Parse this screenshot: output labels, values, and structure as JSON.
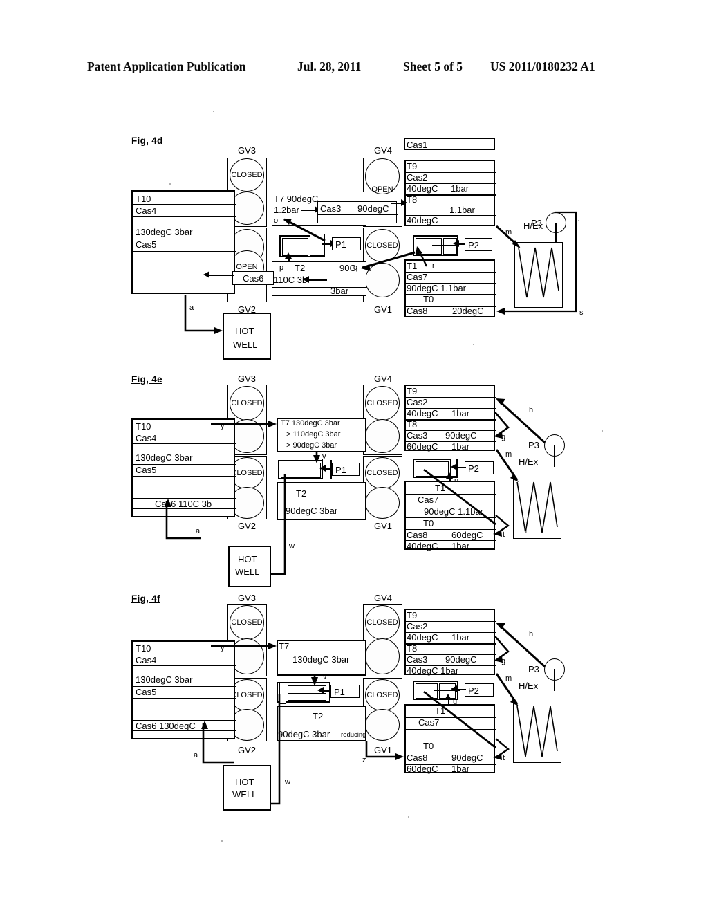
{
  "header": {
    "publication": "Patent Application Publication",
    "date": "Jul. 28, 2011",
    "sheet": "Sheet 5 of 5",
    "number": "US 2011/0180232 A1"
  },
  "figures": [
    {
      "id": "fig4d",
      "label": "Fig, 4d",
      "valve_stacks": [
        {
          "name": "GV3",
          "position": "top-left",
          "cells": [
            "CLOSED",
            ""
          ]
        },
        {
          "name": "GV2",
          "position": "bottom-left",
          "cells": [
            "",
            "OPEN"
          ]
        },
        {
          "name": "GV4",
          "position": "top-right",
          "cells": [
            "",
            "OPEN"
          ]
        },
        {
          "name": "GV1",
          "position": "bottom-right",
          "cells": [
            "CLOSED",
            ""
          ]
        }
      ],
      "left_vessel": {
        "rows": [
          "T10",
          "Cas4",
          "",
          "130degC 3bar",
          "Cas5",
          "",
          ""
        ]
      },
      "center": {
        "t7_label": "T7 90degC",
        "t7_pressure": "1.2bar",
        "t7_tap": "o",
        "cas3_label": "Cas3",
        "cas3_value": "90degC",
        "pump": "P1",
        "t2_tap": "p",
        "t2_label": "T2",
        "t2_temp": "90C",
        "t2_tap_right": "q",
        "cas6_label": "Cas6",
        "cas6_value": "110C 3b",
        "t2_pressure": "3bar"
      },
      "right_vessel": {
        "cas1": "Cas1",
        "rows": [
          {
            "t": "T9"
          },
          {
            "t": "Cas2"
          },
          {
            "t": "40degC",
            "v": "1bar"
          },
          {
            "t": "T8"
          },
          {
            "t": "",
            "v": "1.1bar"
          },
          {
            "t": "40degC"
          }
        ],
        "pump": "P2",
        "lower_rows": [
          {
            "t": "T1",
            "v": "r"
          },
          {
            "t": "Cas7"
          },
          {
            "t": "90degC 1.1bar"
          },
          {
            "t": "T0"
          },
          {
            "t": "Cas8",
            "v": "20degC"
          },
          {
            "t": ""
          }
        ]
      },
      "hx": {
        "pump": "P3",
        "label": "H/Ex",
        "line_m": "m",
        "line_s": "s"
      },
      "hotwell": {
        "line1": "HOT",
        "line2": "WELL",
        "line_a": "a"
      }
    },
    {
      "id": "fig4e",
      "label": "Fig, 4e",
      "valve_stacks": [
        {
          "name": "GV3",
          "position": "top-left",
          "cells": [
            "CLOSED",
            ""
          ]
        },
        {
          "name": "GV2",
          "position": "bottom-left",
          "cells": [
            "CLOSED",
            ""
          ]
        },
        {
          "name": "GV4",
          "position": "top-right",
          "cells": [
            "CLOSED",
            ""
          ]
        },
        {
          "name": "GV1",
          "position": "bottom-right",
          "cells": [
            "CLOSED",
            ""
          ]
        }
      ],
      "left_vessel": {
        "rows": [
          "T10",
          "Cas4",
          "",
          "130degC 3bar",
          "Cas5",
          "",
          "Cas6  110C 3b",
          ""
        ],
        "tap_y": "y"
      },
      "center": {
        "t7_line1": "T7   130degC 3bar",
        "t7_line2": "> 110degC 3bar",
        "t7_line3": ">  90degC 3bar",
        "tap_v": "v",
        "pump": "P1",
        "t2_label": "T2",
        "t2_value": "90degC 3bar",
        "line_w": "w"
      },
      "right_vessel": {
        "rows": [
          {
            "t": "T9"
          },
          {
            "t": "Cas2"
          },
          {
            "t": "40degC",
            "v": "1bar"
          },
          {
            "t": "T8"
          },
          {
            "t": "Cas3",
            "v": "90degC"
          },
          {
            "t": "60degC",
            "v": "1bar"
          }
        ],
        "pump": "P2",
        "tap_u": "u",
        "lower_rows": [
          {
            "t": "T1"
          },
          {
            "t": "Cas7"
          },
          {
            "t": "90degC 1.1bar"
          },
          {
            "t": "T0"
          },
          {
            "t": "Cas8",
            "v": "60degC"
          },
          {
            "t": "40degC",
            "v": "1bar"
          }
        ]
      },
      "hx": {
        "pump": "P3",
        "label": "H/Ex",
        "line_m": "m",
        "line_h": "h",
        "line_g": "g",
        "line_t": "t"
      },
      "hotwell": {
        "line1": "HOT",
        "line2": "WELL",
        "line_a": "a"
      }
    },
    {
      "id": "fig4f",
      "label": "Fig, 4f",
      "valve_stacks": [
        {
          "name": "GV3",
          "position": "top-left",
          "cells": [
            "CLOSED",
            ""
          ]
        },
        {
          "name": "GV2",
          "position": "bottom-left",
          "cells": [
            "CLOSED",
            ""
          ]
        },
        {
          "name": "GV4",
          "position": "top-right",
          "cells": [
            "CLOSED",
            ""
          ]
        },
        {
          "name": "GV1",
          "position": "bottom-right",
          "cells": [
            "CLOSED",
            ""
          ]
        }
      ],
      "left_vessel": {
        "rows": [
          "T10",
          "Cas4",
          "",
          "130degC 3bar",
          "Cas5",
          "",
          "Cas6   130degC",
          ""
        ],
        "tap_y": "y"
      },
      "center": {
        "t7_label": "T7",
        "t7_value": "130degC 3bar",
        "tap_v": "v",
        "pump": "P1",
        "t2_label": "T2",
        "t2_value": "90degC 3bar",
        "t2_note": "reducing",
        "line_w": "w",
        "line_z": "z"
      },
      "right_vessel": {
        "rows": [
          {
            "t": "T9"
          },
          {
            "t": "Cas2"
          },
          {
            "t": "40degC",
            "v": "1bar"
          },
          {
            "t": "T8"
          },
          {
            "t": "Cas3",
            "v": "90degC"
          },
          {
            "t": "40degC 1bar"
          }
        ],
        "pump": "P2",
        "tap_u": "u",
        "lower_rows": [
          {
            "t": "T1"
          },
          {
            "t": "Cas7"
          },
          {
            "t": ""
          },
          {
            "t": "T0"
          },
          {
            "t": "Cas8",
            "v": "90degC"
          },
          {
            "t": "60degC",
            "v": "1bar"
          }
        ]
      },
      "hx": {
        "pump": "P3",
        "label": "H/Ex",
        "line_m": "m",
        "line_h": "h",
        "line_g": "g",
        "line_t": "t"
      },
      "hotwell": {
        "line1": "HOT",
        "line2": "WELL",
        "line_a": "a"
      }
    }
  ]
}
